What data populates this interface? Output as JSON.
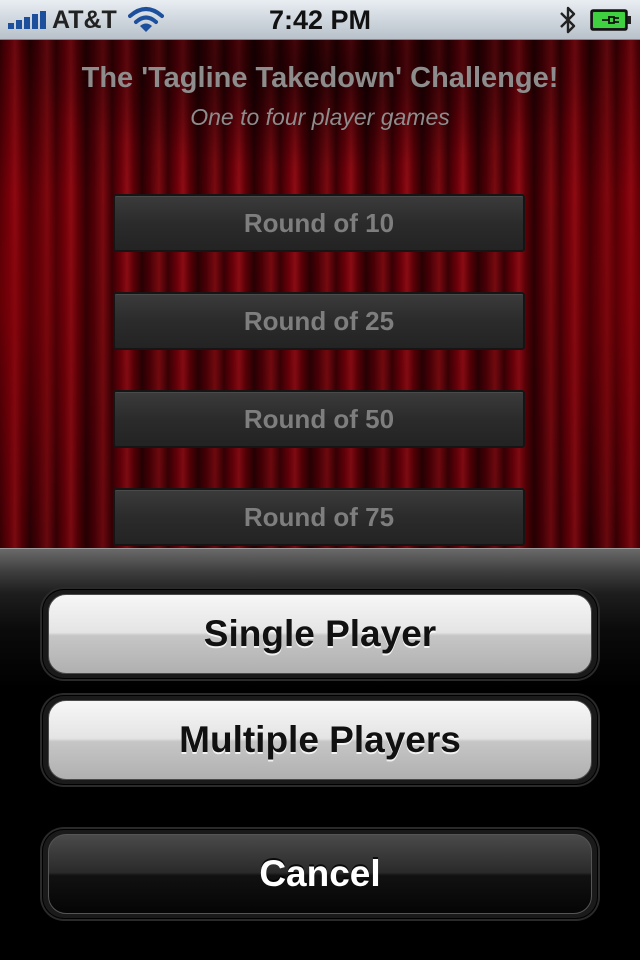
{
  "status_bar": {
    "carrier": "AT&T",
    "time": "7:42 PM",
    "signal_icon": "signal-bars-icon",
    "wifi_icon": "wifi-icon",
    "bluetooth_icon": "bluetooth-icon",
    "battery_icon": "battery-charging-icon"
  },
  "main": {
    "title": "The 'Tagline Takedown' Challenge!",
    "subtitle": "One to four player games",
    "round_buttons": [
      {
        "label": "Round of 10"
      },
      {
        "label": "Round of 25"
      },
      {
        "label": "Round of 50"
      },
      {
        "label": "Round of 75"
      }
    ]
  },
  "action_sheet": {
    "single_player_label": "Single Player",
    "multiple_players_label": "Multiple Players",
    "cancel_label": "Cancel"
  },
  "colors": {
    "curtain_red": "#6e0009",
    "signal_blue": "#1c4f9c",
    "battery_green": "#3fd13f"
  }
}
